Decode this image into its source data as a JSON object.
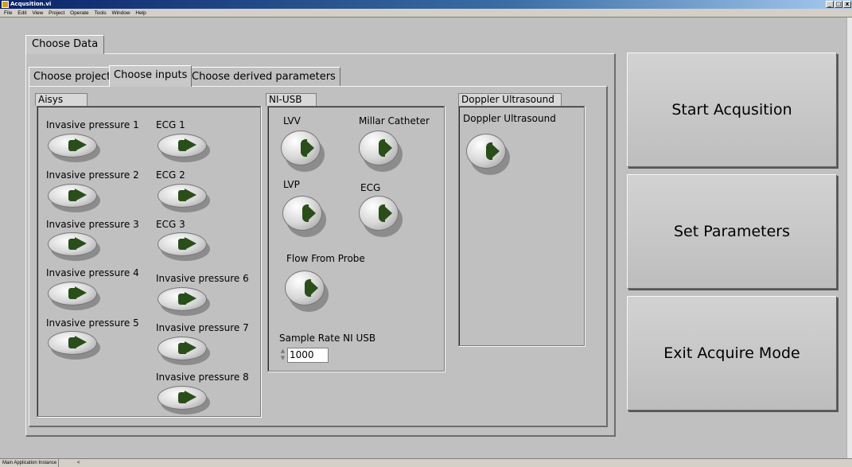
{
  "window": {
    "title": "Acqusition.vi",
    "controls": [
      "_",
      "□",
      "x"
    ]
  },
  "menu": [
    "File",
    "Edit",
    "View",
    "Project",
    "Operate",
    "Tools",
    "Window",
    "Help"
  ],
  "main_tab": {
    "label": "Choose Data"
  },
  "inner_tabs": [
    {
      "label": "Choose project",
      "active": false
    },
    {
      "label": "Choose inputs",
      "active": true
    },
    {
      "label": "Choose derived parameters",
      "active": false
    }
  ],
  "aisys": {
    "title": "Aisys",
    "col1": [
      "Invasive pressure 1",
      "Invasive pressure 2",
      "Invasive pressure 3",
      "Invasive pressure 4",
      "Invasive pressure 5"
    ],
    "col2": [
      "ECG 1",
      "ECG 2",
      "ECG 3",
      "Invasive pressure 6",
      "Invasive pressure 7",
      "Invasive pressure 8"
    ]
  },
  "niusb": {
    "title": "NI-USB",
    "lvv": "LVV",
    "millar": "Millar Catheter",
    "lvp": "LVP",
    "ecg": "ECG",
    "flow": "Flow From Probe",
    "sample_rate_label": "Sample Rate NI USB",
    "sample_rate_value": "1000"
  },
  "doppler": {
    "title": "Doppler Ultrasound",
    "button_label": "Doppler Ultrasound"
  },
  "actions": {
    "start": "Start Acqusition",
    "set_params": "Set Parameters",
    "exit": "Exit Acquire Mode"
  },
  "status": {
    "instance": "Main Application Instance",
    "arrow": "<"
  },
  "colors": {
    "button_indicator": "#2a4e1a",
    "panel": "#c0c0c0"
  },
  "icons": {
    "button_glyph": "play-triangle-icon"
  }
}
